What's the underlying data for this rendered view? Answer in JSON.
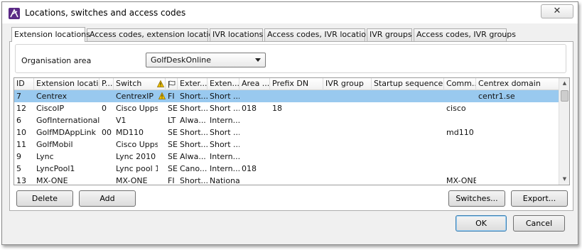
{
  "window": {
    "title": "Locations, switches and access codes",
    "close_glyph": "✕"
  },
  "tabs": [
    {
      "label": "Extension locations",
      "active": true
    },
    {
      "label": "Access codes, extension locations",
      "active": false
    },
    {
      "label": "IVR locations",
      "active": false
    },
    {
      "label": "Access codes, IVR locations",
      "active": false
    },
    {
      "label": "IVR groups",
      "active": false
    },
    {
      "label": "Access codes, IVR groups",
      "active": false
    }
  ],
  "organisation": {
    "label": "Organisation area",
    "selected": "GolfDeskOnline"
  },
  "table": {
    "columns": [
      "ID",
      "Extension location",
      "P...",
      "Switch",
      "",
      "Exter...",
      "Exten...",
      "Area ...",
      "Prefix DN",
      "IVR group",
      "Startup sequence",
      "Comm...",
      "Centrex domain"
    ],
    "rows": [
      {
        "id": "7",
        "location": "Centrex",
        "p": "",
        "switch": "CentrexIP",
        "warn": true,
        "country": "FI",
        "ext1": "Short...",
        "ext2": "Short ...",
        "area": "",
        "prefix": "",
        "ivr": "",
        "startup": "",
        "comm": "",
        "centrex": "centr1.se",
        "selected": true
      },
      {
        "id": "12",
        "location": "CiscoIP",
        "p": "0",
        "switch": "Cisco Uppsala",
        "warn": false,
        "country": "SE",
        "ext1": "Short...",
        "ext2": "Short ...",
        "area": "018",
        "prefix": "18",
        "ivr": "",
        "startup": "",
        "comm": "cisco",
        "centrex": "",
        "selected": false
      },
      {
        "id": "6",
        "location": "GofInternational",
        "p": "",
        "switch": "V1",
        "warn": false,
        "country": "LT",
        "ext1": "Alwa...",
        "ext2": "Intern...",
        "area": "",
        "prefix": "",
        "ivr": "",
        "startup": "",
        "comm": "",
        "centrex": "",
        "selected": false
      },
      {
        "id": "10",
        "location": "GolfMDAppLink",
        "p": "00",
        "switch": "MD110",
        "warn": false,
        "country": "SE",
        "ext1": "Short...",
        "ext2": "Short ...",
        "area": "",
        "prefix": "",
        "ivr": "",
        "startup": "",
        "comm": "md110",
        "centrex": "",
        "selected": false
      },
      {
        "id": "11",
        "location": "GolfMobil",
        "p": "",
        "switch": "Cisco Uppsala",
        "warn": false,
        "country": "SE",
        "ext1": "Short...",
        "ext2": "Short ...",
        "area": "",
        "prefix": "",
        "ivr": "",
        "startup": "",
        "comm": "",
        "centrex": "",
        "selected": false
      },
      {
        "id": "9",
        "location": "Lync",
        "p": "",
        "switch": "Lync 2010",
        "warn": false,
        "country": "SE",
        "ext1": "Alwa...",
        "ext2": "Intern...",
        "area": "",
        "prefix": "",
        "ivr": "",
        "startup": "",
        "comm": "",
        "centrex": "",
        "selected": false
      },
      {
        "id": "5",
        "location": "LyncPool1",
        "p": "",
        "switch": "Lync pool 1",
        "warn": false,
        "country": "SE",
        "ext1": "Cano...",
        "ext2": "Intern...",
        "area": "018",
        "prefix": "",
        "ivr": "",
        "startup": "",
        "comm": "",
        "centrex": "",
        "selected": false
      },
      {
        "id": "13",
        "location": "MX-ONE",
        "p": "",
        "switch": "MX-ONE",
        "warn": false,
        "country": "FI",
        "ext1": "Short...",
        "ext2": "National",
        "area": "",
        "prefix": "",
        "ivr": "",
        "startup": "",
        "comm": "MX-ONE",
        "centrex": "",
        "selected": false
      }
    ]
  },
  "buttons": {
    "delete": "Delete",
    "add": "Add",
    "switches": "Switches...",
    "export": "Export...",
    "ok": "OK",
    "cancel": "Cancel"
  },
  "colors": {
    "selection": "#99c9ef",
    "app_icon": "#5b2a86",
    "warning": "#f2c200"
  },
  "icons": {
    "app": "app-logo-icon",
    "warning": "warning-icon",
    "flag_header": "flag-icon",
    "dropdown": "chevron-down-icon"
  }
}
